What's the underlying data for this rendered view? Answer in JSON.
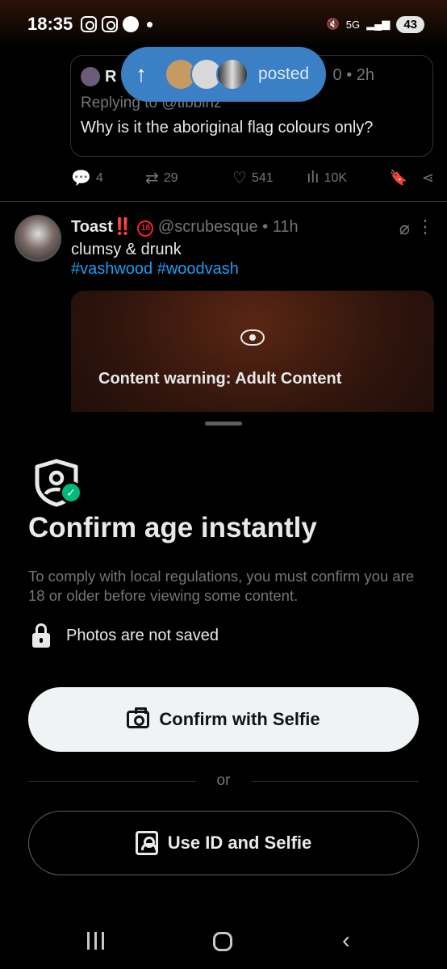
{
  "status_bar": {
    "time": "18:35",
    "network": "5G",
    "battery": "43"
  },
  "posted_pill": {
    "label": "posted"
  },
  "quoted_tweet": {
    "name_initial": "R",
    "time_fragment": "0 • 2h",
    "replying": "Replying to @tibbinz",
    "text": "Why is it the aboriginal flag colours only?"
  },
  "actions": {
    "replies": "4",
    "retweets": "29",
    "likes": "541",
    "views": "10K"
  },
  "tweet": {
    "name": "Toast",
    "name_suffix": "‼️",
    "age_badge": "18",
    "handle_time": "@scrubesque • 11h",
    "text": "clumsy & drunk",
    "hashtags": "#vashwood #woodvash",
    "content_warning": "Content warning: Adult Content"
  },
  "sheet": {
    "title": "Confirm age instantly",
    "description": "To comply with local regulations, you must confirm you are 18 or older before viewing some content.",
    "photos_note": "Photos are not saved",
    "selfie_button": "Confirm with Selfie",
    "or_text": "or",
    "id_button": "Use ID and Selfie"
  },
  "colors": {
    "accent": "#1d9bf0",
    "success": "#00ba7c",
    "pill": "#3b7fc4"
  }
}
